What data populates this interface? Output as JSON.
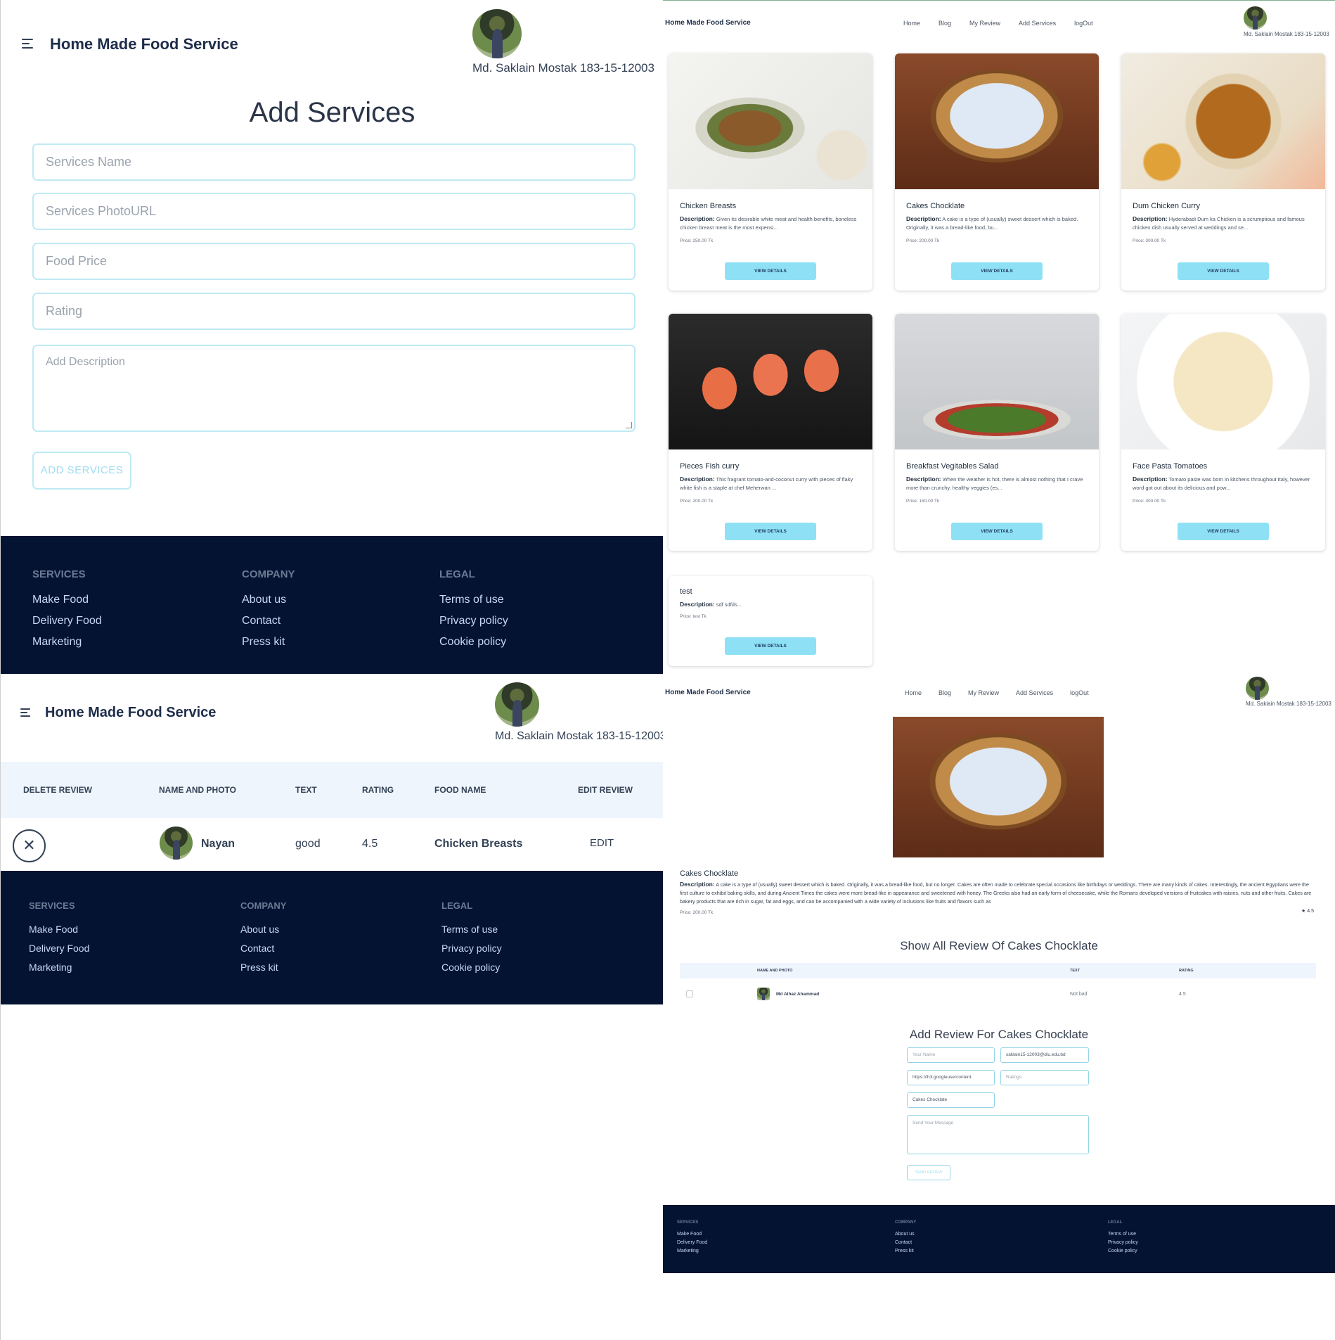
{
  "brand": "Home Made Food Service",
  "user_name": "Md. Saklain Mostak 183-15-12003",
  "nav": [
    "Home",
    "Blog",
    "My Review",
    "Add Services",
    "logOut"
  ],
  "add_services": {
    "title": "Add Services",
    "name_placeholder": "Services Name",
    "photo_placeholder": "Services PhotoURL",
    "price_placeholder": "Food Price",
    "rating_placeholder": "Rating",
    "description_placeholder": "Add Description",
    "submit_label": "ADD SERVICES"
  },
  "footer": {
    "services_heading": "SERVICES",
    "services_links": [
      "Make Food",
      "Delivery Food",
      "Marketing"
    ],
    "company_heading": "COMPANY",
    "company_links": [
      "About us",
      "Contact",
      "Press kit"
    ],
    "legal_heading": "LEGAL",
    "legal_links": [
      "Terms of use",
      "Privacy policy",
      "Cookie policy"
    ]
  },
  "services": [
    {
      "title": "Chicken Breasts",
      "desc_label": "Description:",
      "desc": "Given its desirable white meat and health benefits, boneless chicken breast meat is the most expensi...",
      "price": "Price: 250.00 Tk",
      "button": "VIEW DETAILS",
      "image": "chicken"
    },
    {
      "title": "Cakes Chocklate",
      "desc_label": "Description:",
      "desc": "A cake is a type of (usually) sweet dessert which is baked. Originally, it was a bread-like food, bu...",
      "price": "Price: 200.00 Tk",
      "button": "VIEW DETAILS",
      "image": "cake"
    },
    {
      "title": "Dum Chicken Curry",
      "desc_label": "Description:",
      "desc": "Hyderabadi Dum ka Chicken is a scrumptious and famous chicken dish usually served at weddings and se...",
      "price": "Price: 300.00 Tk",
      "button": "VIEW DETAILS",
      "image": "curry"
    },
    {
      "title": "Pieces Fish curry",
      "desc_label": "Description:",
      "desc": "This fragrant tomato-and-coconut curry with pieces of flaky white fish is a staple at chef Meherwan ...",
      "price": "Price: 200.00 Tk",
      "button": "VIEW DETAILS",
      "image": "fish"
    },
    {
      "title": "Breakfast Vegitables Salad",
      "desc_label": "Description:",
      "desc": "When the weather is hot, there is almost nothing that I crave more than crunchy, healthy veggies (es...",
      "price": "Price: 150.00 Tk",
      "button": "VIEW DETAILS",
      "image": "salad"
    },
    {
      "title": "Face Pasta Tomatoes",
      "desc_label": "Description:",
      "desc": "Tomato paste was born in kitchens throughout Italy, however word got out about its delicious and pow...",
      "price": "Price: 300.00 Tk",
      "button": "VIEW DETAILS",
      "image": "pasta"
    },
    {
      "title": "test",
      "desc_label": "Description:",
      "desc": "sdf sdfds...",
      "price": "Price: test Tk",
      "button": "VIEW DETAILS",
      "image": ""
    }
  ],
  "my_review": {
    "headers": [
      "DELETE REVIEW",
      "NAME AND PHOTO",
      "TEXT",
      "RATING",
      "FOOD NAME",
      "EDIT REVIEW"
    ],
    "row": {
      "name": "Nayan",
      "text": "good",
      "rating": "4.5",
      "food": "Chicken Breasts",
      "edit": "EDIT",
      "delete_icon": "✕"
    }
  },
  "details": {
    "title": "Cakes Chocklate",
    "desc_label": "Description:",
    "desc": "A cake is a type of (usually) sweet dessert which is baked. Originally, it was a bread-like food, but no longer. Cakes are often made to celebrate special occasions like birthdays or weddings. There are many kinds of cakes. Interestingly, the ancient Egyptians were the first culture to exhibit baking skills, and during Ancient Times the cakes were more bread-like in appearance and sweetened with honey. The Greeks also had an early form of cheesecake, while the Romans developed versions of fruitcakes with raisins, nuts and other fruits. Cakes are bakery products that are rich in sugar, fat and eggs, and can be accompanied with a wide variety of inclusions like fruits and flavors such as",
    "price": "Price: 200.00 Tk",
    "rating": "★ 4.5",
    "reviews_title": "Show All Review Of Cakes Chocklate",
    "review_headers": [
      "NAME AND PHOTO",
      "TEXT",
      "RATING"
    ],
    "review_row": {
      "name": "Md Alhaz Ahammad",
      "text": "Not bad",
      "rating": "4.5"
    },
    "add_review_title": "Add Review For Cakes Chocklate",
    "form": {
      "name_placeholder": "Your Name",
      "email_value": "saklain15-12003@diu.edu.bd",
      "photo_value": "https://lh3.googleusercontent.",
      "rating_placeholder": "Ratings",
      "food_value": "Cakes Chocklate",
      "message_placeholder": "Send Your Message",
      "send_label": "SEND REVIEW"
    }
  }
}
